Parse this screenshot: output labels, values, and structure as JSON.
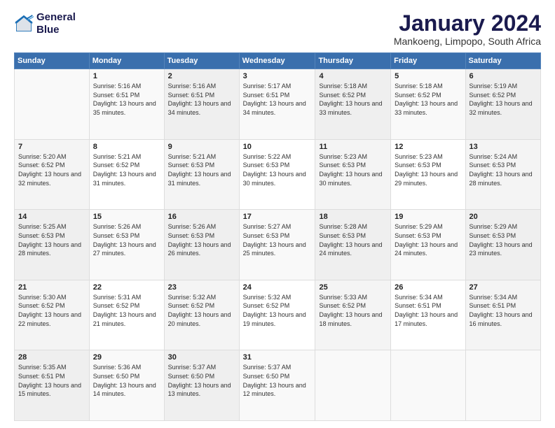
{
  "logo": {
    "line1": "General",
    "line2": "Blue"
  },
  "title": "January 2024",
  "subtitle": "Mankoeng, Limpopo, South Africa",
  "days_of_week": [
    "Sunday",
    "Monday",
    "Tuesday",
    "Wednesday",
    "Thursday",
    "Friday",
    "Saturday"
  ],
  "weeks": [
    [
      {
        "day": "",
        "sunrise": "",
        "sunset": "",
        "daylight": ""
      },
      {
        "day": "1",
        "sunrise": "Sunrise: 5:16 AM",
        "sunset": "Sunset: 6:51 PM",
        "daylight": "Daylight: 13 hours and 35 minutes."
      },
      {
        "day": "2",
        "sunrise": "Sunrise: 5:16 AM",
        "sunset": "Sunset: 6:51 PM",
        "daylight": "Daylight: 13 hours and 34 minutes."
      },
      {
        "day": "3",
        "sunrise": "Sunrise: 5:17 AM",
        "sunset": "Sunset: 6:51 PM",
        "daylight": "Daylight: 13 hours and 34 minutes."
      },
      {
        "day": "4",
        "sunrise": "Sunrise: 5:18 AM",
        "sunset": "Sunset: 6:52 PM",
        "daylight": "Daylight: 13 hours and 33 minutes."
      },
      {
        "day": "5",
        "sunrise": "Sunrise: 5:18 AM",
        "sunset": "Sunset: 6:52 PM",
        "daylight": "Daylight: 13 hours and 33 minutes."
      },
      {
        "day": "6",
        "sunrise": "Sunrise: 5:19 AM",
        "sunset": "Sunset: 6:52 PM",
        "daylight": "Daylight: 13 hours and 32 minutes."
      }
    ],
    [
      {
        "day": "7",
        "sunrise": "Sunrise: 5:20 AM",
        "sunset": "Sunset: 6:52 PM",
        "daylight": "Daylight: 13 hours and 32 minutes."
      },
      {
        "day": "8",
        "sunrise": "Sunrise: 5:21 AM",
        "sunset": "Sunset: 6:52 PM",
        "daylight": "Daylight: 13 hours and 31 minutes."
      },
      {
        "day": "9",
        "sunrise": "Sunrise: 5:21 AM",
        "sunset": "Sunset: 6:53 PM",
        "daylight": "Daylight: 13 hours and 31 minutes."
      },
      {
        "day": "10",
        "sunrise": "Sunrise: 5:22 AM",
        "sunset": "Sunset: 6:53 PM",
        "daylight": "Daylight: 13 hours and 30 minutes."
      },
      {
        "day": "11",
        "sunrise": "Sunrise: 5:23 AM",
        "sunset": "Sunset: 6:53 PM",
        "daylight": "Daylight: 13 hours and 30 minutes."
      },
      {
        "day": "12",
        "sunrise": "Sunrise: 5:23 AM",
        "sunset": "Sunset: 6:53 PM",
        "daylight": "Daylight: 13 hours and 29 minutes."
      },
      {
        "day": "13",
        "sunrise": "Sunrise: 5:24 AM",
        "sunset": "Sunset: 6:53 PM",
        "daylight": "Daylight: 13 hours and 28 minutes."
      }
    ],
    [
      {
        "day": "14",
        "sunrise": "Sunrise: 5:25 AM",
        "sunset": "Sunset: 6:53 PM",
        "daylight": "Daylight: 13 hours and 28 minutes."
      },
      {
        "day": "15",
        "sunrise": "Sunrise: 5:26 AM",
        "sunset": "Sunset: 6:53 PM",
        "daylight": "Daylight: 13 hours and 27 minutes."
      },
      {
        "day": "16",
        "sunrise": "Sunrise: 5:26 AM",
        "sunset": "Sunset: 6:53 PM",
        "daylight": "Daylight: 13 hours and 26 minutes."
      },
      {
        "day": "17",
        "sunrise": "Sunrise: 5:27 AM",
        "sunset": "Sunset: 6:53 PM",
        "daylight": "Daylight: 13 hours and 25 minutes."
      },
      {
        "day": "18",
        "sunrise": "Sunrise: 5:28 AM",
        "sunset": "Sunset: 6:53 PM",
        "daylight": "Daylight: 13 hours and 24 minutes."
      },
      {
        "day": "19",
        "sunrise": "Sunrise: 5:29 AM",
        "sunset": "Sunset: 6:53 PM",
        "daylight": "Daylight: 13 hours and 24 minutes."
      },
      {
        "day": "20",
        "sunrise": "Sunrise: 5:29 AM",
        "sunset": "Sunset: 6:53 PM",
        "daylight": "Daylight: 13 hours and 23 minutes."
      }
    ],
    [
      {
        "day": "21",
        "sunrise": "Sunrise: 5:30 AM",
        "sunset": "Sunset: 6:52 PM",
        "daylight": "Daylight: 13 hours and 22 minutes."
      },
      {
        "day": "22",
        "sunrise": "Sunrise: 5:31 AM",
        "sunset": "Sunset: 6:52 PM",
        "daylight": "Daylight: 13 hours and 21 minutes."
      },
      {
        "day": "23",
        "sunrise": "Sunrise: 5:32 AM",
        "sunset": "Sunset: 6:52 PM",
        "daylight": "Daylight: 13 hours and 20 minutes."
      },
      {
        "day": "24",
        "sunrise": "Sunrise: 5:32 AM",
        "sunset": "Sunset: 6:52 PM",
        "daylight": "Daylight: 13 hours and 19 minutes."
      },
      {
        "day": "25",
        "sunrise": "Sunrise: 5:33 AM",
        "sunset": "Sunset: 6:52 PM",
        "daylight": "Daylight: 13 hours and 18 minutes."
      },
      {
        "day": "26",
        "sunrise": "Sunrise: 5:34 AM",
        "sunset": "Sunset: 6:51 PM",
        "daylight": "Daylight: 13 hours and 17 minutes."
      },
      {
        "day": "27",
        "sunrise": "Sunrise: 5:34 AM",
        "sunset": "Sunset: 6:51 PM",
        "daylight": "Daylight: 13 hours and 16 minutes."
      }
    ],
    [
      {
        "day": "28",
        "sunrise": "Sunrise: 5:35 AM",
        "sunset": "Sunset: 6:51 PM",
        "daylight": "Daylight: 13 hours and 15 minutes."
      },
      {
        "day": "29",
        "sunrise": "Sunrise: 5:36 AM",
        "sunset": "Sunset: 6:50 PM",
        "daylight": "Daylight: 13 hours and 14 minutes."
      },
      {
        "day": "30",
        "sunrise": "Sunrise: 5:37 AM",
        "sunset": "Sunset: 6:50 PM",
        "daylight": "Daylight: 13 hours and 13 minutes."
      },
      {
        "day": "31",
        "sunrise": "Sunrise: 5:37 AM",
        "sunset": "Sunset: 6:50 PM",
        "daylight": "Daylight: 13 hours and 12 minutes."
      },
      {
        "day": "",
        "sunrise": "",
        "sunset": "",
        "daylight": ""
      },
      {
        "day": "",
        "sunrise": "",
        "sunset": "",
        "daylight": ""
      },
      {
        "day": "",
        "sunrise": "",
        "sunset": "",
        "daylight": ""
      }
    ]
  ]
}
